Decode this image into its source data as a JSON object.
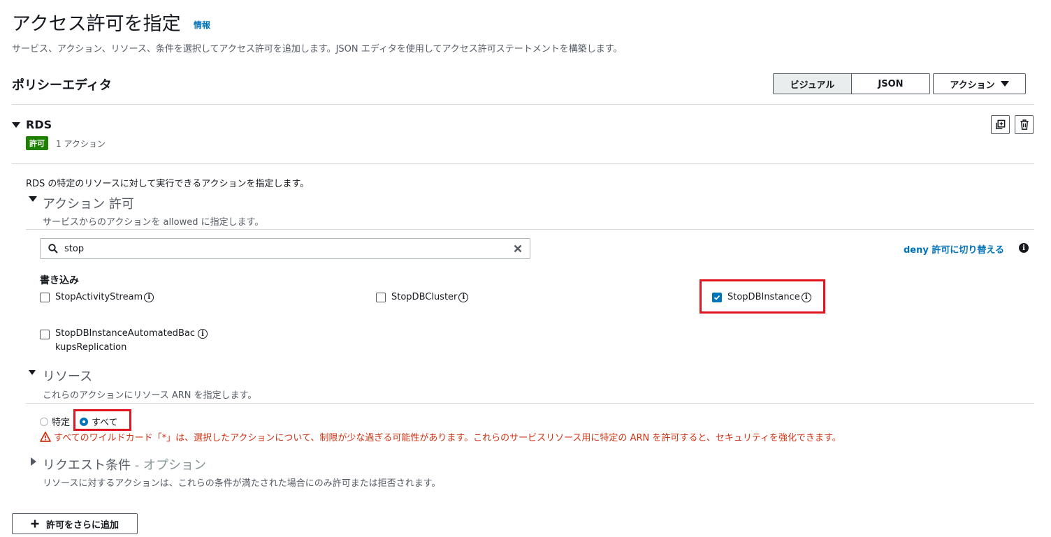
{
  "header": {
    "title": "アクセス許可を指定",
    "info_link": "情報",
    "subtitle": "サービス、アクション、リソース、条件を選択してアクセス許可を追加します。JSON エディタを使用してアクセス許可ステートメントを構築します。"
  },
  "editor": {
    "title": "ポリシーエディタ",
    "visual_tab": "ビジュアル",
    "json_tab": "JSON",
    "actions_button": "アクション"
  },
  "service": {
    "name": "RDS",
    "badge": "許可",
    "action_count": "1 アクション",
    "description": "RDS の特定のリソースに対して実行できるアクションを指定します。"
  },
  "actions_section": {
    "title": "アクション 許可",
    "subtitle": "サービスからのアクションを allowed に指定します。",
    "search_value": "stop",
    "deny_link": "deny 許可に切り替える",
    "group_title": "書き込み",
    "items": [
      {
        "label": "StopActivityStream",
        "checked": false
      },
      {
        "label": "StopDBCluster",
        "checked": false
      },
      {
        "label": "StopDBInstance",
        "checked": true
      },
      {
        "label_line1": "StopDBInstanceAutomatedBac",
        "label_line2": "kupsReplication",
        "checked": false
      }
    ]
  },
  "resources_section": {
    "title": "リソース",
    "subtitle": "これらのアクションにリソース ARN を指定します。",
    "option_specific": "特定",
    "option_all": "すべて",
    "selected": "すべて",
    "warning": "すべてのワイルドカード「*」は、選択したアクションについて、制限が少な過ぎる可能性があります。これらのサービスリソース用に特定の ARN を許可すると、セキュリティを強化できます。"
  },
  "conditions_section": {
    "title_main": "リクエスト条件",
    "title_suffix": " - オプション",
    "subtitle": "リソースに対するアクションは、これらの条件が満たされた場合にのみ許可または拒否されます。"
  },
  "footer": {
    "add_button": "許可をさらに追加"
  },
  "colors": {
    "link": "#0073bb",
    "allow_badge": "#1d8102",
    "warning": "#d13212",
    "highlight": "#e0141e"
  }
}
